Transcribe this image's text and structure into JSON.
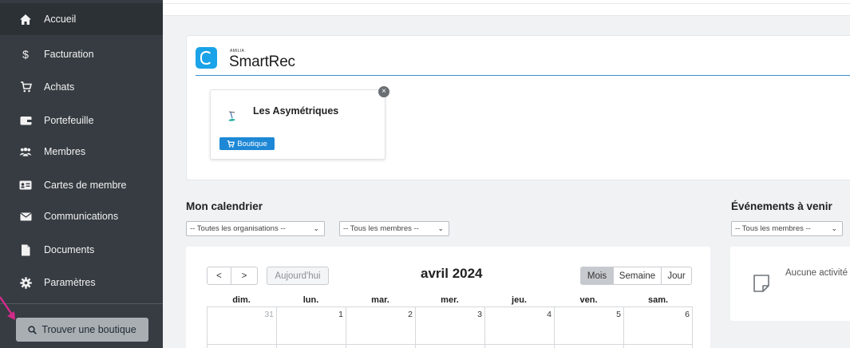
{
  "sidebar": {
    "items": [
      {
        "label": "Accueil",
        "icon": "home-icon"
      },
      {
        "label": "Facturation",
        "icon": "dollar-icon"
      },
      {
        "label": "Achats",
        "icon": "cart-icon"
      },
      {
        "label": "Portefeuille",
        "icon": "wallet-icon"
      },
      {
        "label": "Membres",
        "icon": "members-icon"
      },
      {
        "label": "Cartes de membre",
        "icon": "id-card-icon"
      },
      {
        "label": "Communications",
        "icon": "envelope-icon"
      },
      {
        "label": "Documents",
        "icon": "document-icon"
      },
      {
        "label": "Paramètres",
        "icon": "gear-icon"
      }
    ],
    "find_button": "Trouver une boutique"
  },
  "brand": {
    "small": "AMILIA",
    "name": "SmartRec",
    "color": "#1aa3e8"
  },
  "store": {
    "name": "Les Asymétriques",
    "tag": "Boutique",
    "close": "×"
  },
  "calendar": {
    "title": "Mon calendrier",
    "org_filter": "-- Toutes les organisations --",
    "member_filter": "-- Tous les membres --",
    "prev": "<",
    "next": ">",
    "today": "Aujourd'hui",
    "month": "avril 2024",
    "views": [
      "Mois",
      "Semaine",
      "Jour"
    ],
    "days": [
      "dim.",
      "lun.",
      "mar.",
      "mer.",
      "jeu.",
      "ven.",
      "sam."
    ],
    "first_week": [
      "31",
      "1",
      "2",
      "3",
      "4",
      "5",
      "6"
    ]
  },
  "events": {
    "title": "Événements à venir",
    "member_filter": "-- Tous les membres --",
    "empty": "Aucune activité"
  },
  "colors": {
    "sidebar": "#363c42",
    "accent": "#1e88d6"
  }
}
